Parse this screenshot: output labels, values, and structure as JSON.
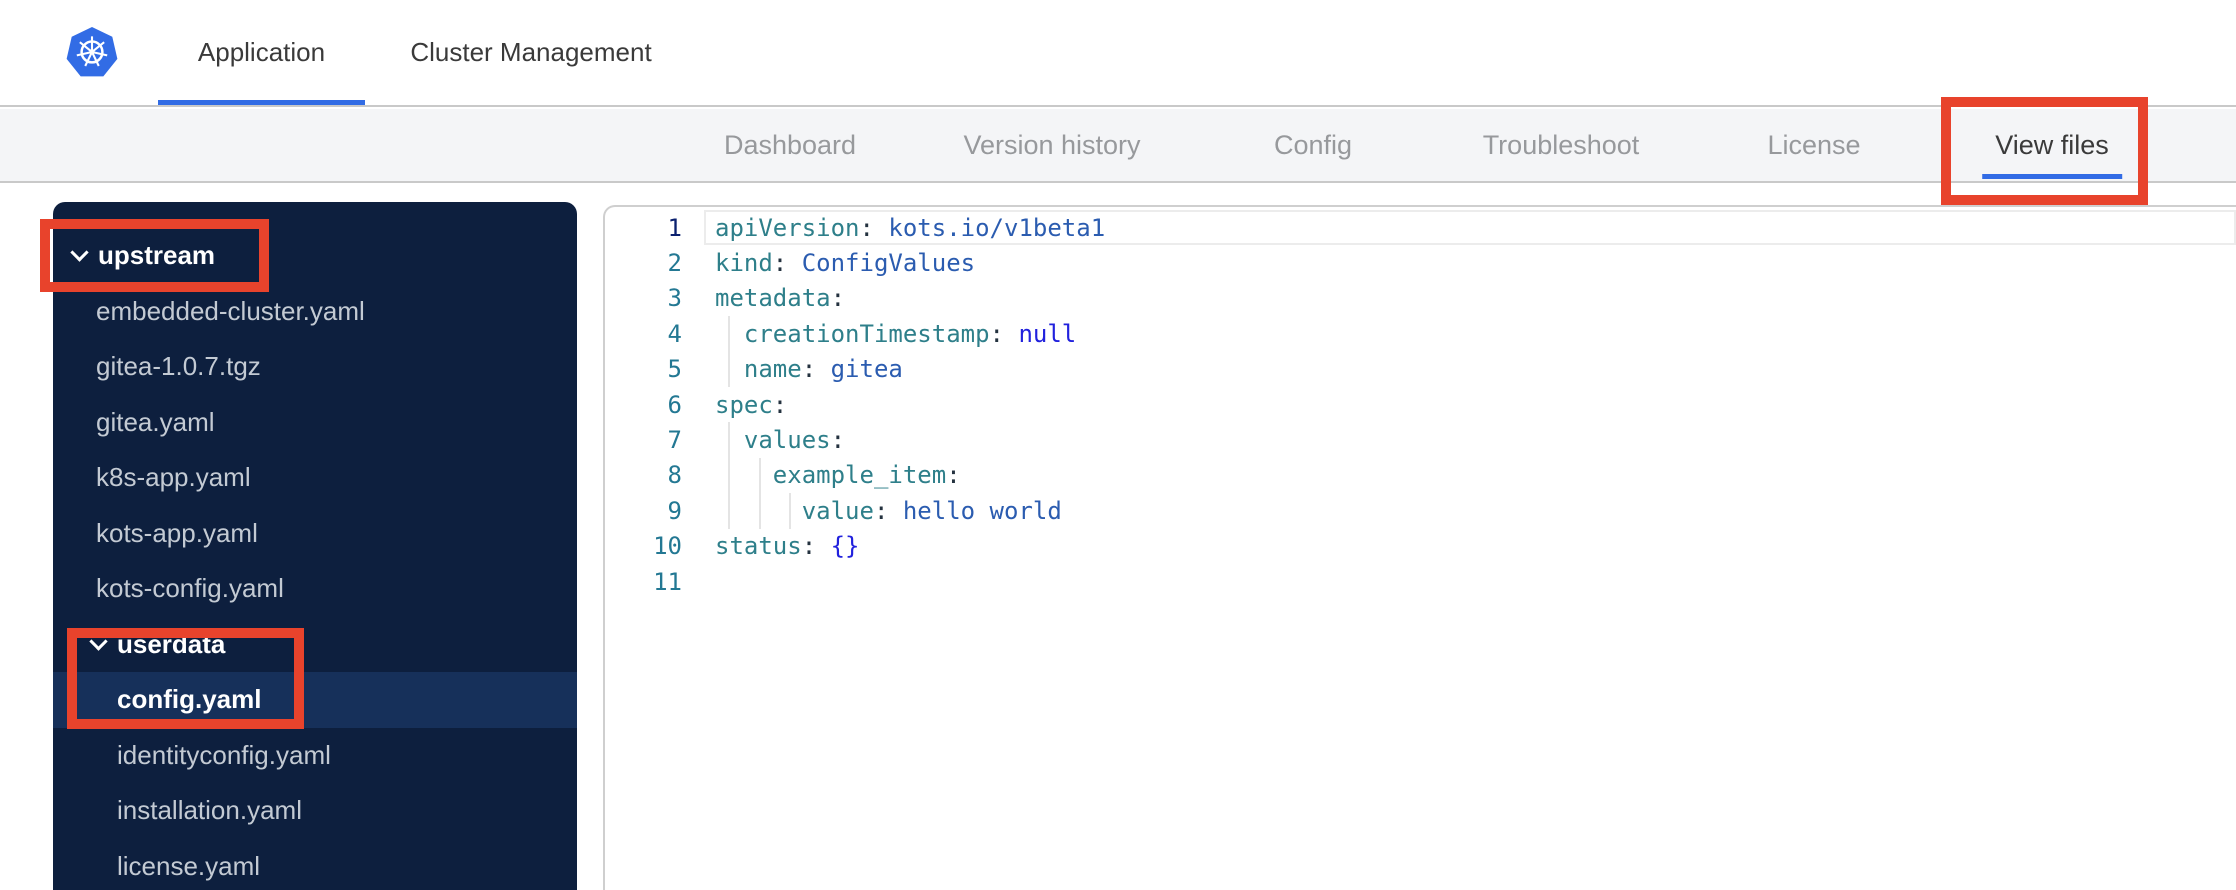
{
  "header": {
    "logo": "kubernetes-logo",
    "tabs": [
      {
        "label": "Application",
        "active": true
      },
      {
        "label": "Cluster Management",
        "active": false
      }
    ]
  },
  "subnav": {
    "tabs": [
      {
        "label": "Dashboard",
        "active": false
      },
      {
        "label": "Version history",
        "active": false
      },
      {
        "label": "Config",
        "active": false
      },
      {
        "label": "Troubleshoot",
        "active": false
      },
      {
        "label": "License",
        "active": false
      },
      {
        "label": "View files",
        "active": true,
        "annotated": true
      }
    ]
  },
  "sidebar": {
    "items": [
      {
        "label": "upstream",
        "type": "folder",
        "depth": 0,
        "expanded": true,
        "annotated": true
      },
      {
        "label": "embedded-cluster.yaml",
        "type": "file",
        "depth": 0
      },
      {
        "label": "gitea-1.0.7.tgz",
        "type": "file",
        "depth": 0
      },
      {
        "label": "gitea.yaml",
        "type": "file",
        "depth": 0
      },
      {
        "label": "k8s-app.yaml",
        "type": "file",
        "depth": 0
      },
      {
        "label": "kots-app.yaml",
        "type": "file",
        "depth": 0
      },
      {
        "label": "kots-config.yaml",
        "type": "file",
        "depth": 0
      },
      {
        "label": "userdata",
        "type": "folder",
        "depth": 1,
        "expanded": true,
        "annotated": true
      },
      {
        "label": "config.yaml",
        "type": "file",
        "depth": 1,
        "selected": true,
        "annotated": true
      },
      {
        "label": "identityconfig.yaml",
        "type": "file",
        "depth": 1
      },
      {
        "label": "installation.yaml",
        "type": "file",
        "depth": 1
      },
      {
        "label": "license.yaml",
        "type": "file",
        "depth": 1
      }
    ]
  },
  "editor": {
    "active_line": 1,
    "lines": [
      {
        "n": 1,
        "tokens": [
          {
            "c": "key",
            "t": "apiVersion"
          },
          {
            "c": "colon",
            "t": ":"
          },
          {
            "c": "str",
            "t": " kots.io/v1beta1"
          }
        ]
      },
      {
        "n": 2,
        "tokens": [
          {
            "c": "key",
            "t": "kind"
          },
          {
            "c": "colon",
            "t": ":"
          },
          {
            "c": "str",
            "t": " ConfigValues"
          }
        ]
      },
      {
        "n": 3,
        "tokens": [
          {
            "c": "key",
            "t": "metadata"
          },
          {
            "c": "colon",
            "t": ":"
          }
        ]
      },
      {
        "n": 4,
        "tokens": [
          {
            "c": "plain",
            "t": "  "
          },
          {
            "c": "key",
            "t": "creationTimestamp"
          },
          {
            "c": "colon",
            "t": ":"
          },
          {
            "c": "kw",
            "t": " null"
          }
        ]
      },
      {
        "n": 5,
        "tokens": [
          {
            "c": "plain",
            "t": "  "
          },
          {
            "c": "key",
            "t": "name"
          },
          {
            "c": "colon",
            "t": ":"
          },
          {
            "c": "str",
            "t": " gitea"
          }
        ]
      },
      {
        "n": 6,
        "tokens": [
          {
            "c": "key",
            "t": "spec"
          },
          {
            "c": "colon",
            "t": ":"
          }
        ]
      },
      {
        "n": 7,
        "tokens": [
          {
            "c": "plain",
            "t": "  "
          },
          {
            "c": "key",
            "t": "values"
          },
          {
            "c": "colon",
            "t": ":"
          }
        ]
      },
      {
        "n": 8,
        "tokens": [
          {
            "c": "plain",
            "t": "    "
          },
          {
            "c": "key",
            "t": "example_item"
          },
          {
            "c": "colon",
            "t": ":"
          }
        ]
      },
      {
        "n": 9,
        "tokens": [
          {
            "c": "plain",
            "t": "      "
          },
          {
            "c": "key",
            "t": "value"
          },
          {
            "c": "colon",
            "t": ":"
          },
          {
            "c": "str",
            "t": " hello world"
          }
        ]
      },
      {
        "n": 10,
        "tokens": [
          {
            "c": "key",
            "t": "status"
          },
          {
            "c": "colon",
            "t": ":"
          },
          {
            "c": "kw",
            "t": " {}"
          }
        ]
      },
      {
        "n": 11,
        "tokens": []
      }
    ]
  },
  "annotations": {
    "color": "#E8432C",
    "boxes": [
      "view-files-tab",
      "upstream-folder",
      "userdata-config-yaml-selection"
    ]
  },
  "colors": {
    "brand_blue": "#326CE5",
    "annotation_red": "#E8432C",
    "sidebar_bg": "#0D1F3E",
    "sidebar_selected_bg": "#16305A",
    "code_key": "#2E7F8A",
    "code_string": "#2B5CB0",
    "code_keyword": "#2121DD",
    "line_number": "#237893",
    "active_line_number": "#0B216F"
  }
}
